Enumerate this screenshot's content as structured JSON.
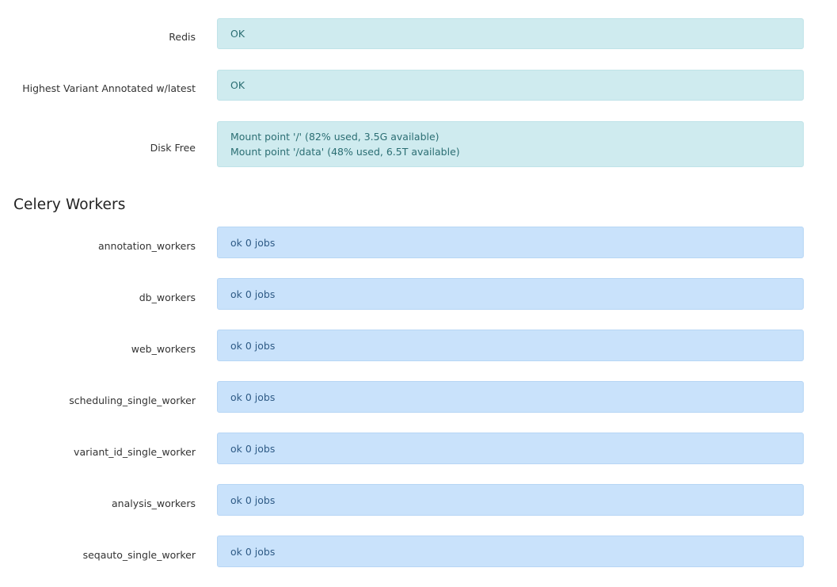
{
  "status_checks": [
    {
      "label": "Redis",
      "lines": [
        "OK"
      ]
    },
    {
      "label": "Highest Variant Annotated w/latest",
      "lines": [
        "OK"
      ]
    },
    {
      "label": "Disk Free",
      "lines": [
        "Mount point '/' (82% used, 3.5G available)",
        "Mount point '/data' (48% used, 6.5T available)"
      ]
    }
  ],
  "celery": {
    "title": "Celery Workers",
    "workers": [
      {
        "label": "annotation_workers",
        "status": "ok 0 jobs"
      },
      {
        "label": "db_workers",
        "status": "ok 0 jobs"
      },
      {
        "label": "web_workers",
        "status": "ok 0 jobs"
      },
      {
        "label": "scheduling_single_worker",
        "status": "ok 0 jobs"
      },
      {
        "label": "variant_id_single_worker",
        "status": "ok 0 jobs"
      },
      {
        "label": "analysis_workers",
        "status": "ok 0 jobs"
      },
      {
        "label": "seqauto_single_worker",
        "status": "ok 0 jobs"
      }
    ]
  },
  "colors": {
    "info_background": "#cfebef",
    "info_text": "#2b6e73",
    "worker_background": "#c9e2fb",
    "worker_text": "#2f5b86"
  }
}
